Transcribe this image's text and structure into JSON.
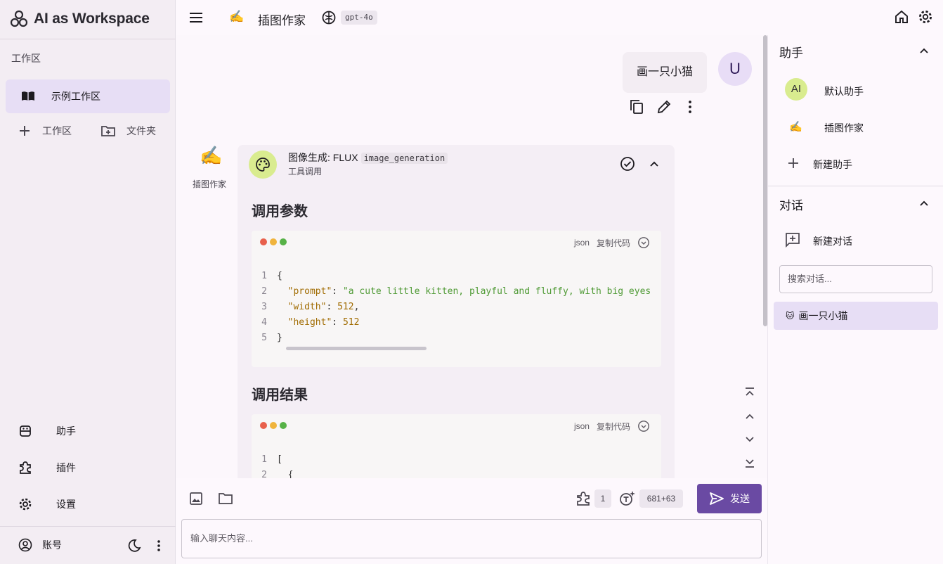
{
  "app": {
    "title": "AI as Workspace"
  },
  "sidebar": {
    "section_label": "工作区",
    "workspace_item": "示例工作区",
    "add_workspace": "工作区",
    "add_folder": "文件夹",
    "nav": [
      {
        "label": "助手",
        "icon": "robot-icon"
      },
      {
        "label": "插件",
        "icon": "puzzle-icon"
      },
      {
        "label": "设置",
        "icon": "gear-icon"
      }
    ],
    "account": "账号"
  },
  "header": {
    "assistant_emoji": "✍️",
    "assistant_name": "插图作家",
    "model": "gpt-4o"
  },
  "chat": {
    "user_message": "画一只小猫",
    "user_avatar": "U",
    "bot_emoji": "✍️",
    "bot_name": "插图作家",
    "tool_call": {
      "title": "图像生成: FLUX",
      "code_name": "image_generation",
      "subtitle": "工具调用",
      "params_heading": "调用参数",
      "result_heading": "调用结果",
      "lang": "json",
      "copy": "复制代码",
      "params_lines": [
        {
          "n": "1",
          "text": "{"
        },
        {
          "n": "2",
          "key": "\"prompt\"",
          "sep": ": ",
          "val": "\"a cute little kitten, playful and fluffy, with big eyes"
        },
        {
          "n": "3",
          "key": "\"width\"",
          "sep": ": ",
          "num": "512",
          "tail": ","
        },
        {
          "n": "4",
          "key": "\"height\"",
          "sep": ": ",
          "num": "512"
        },
        {
          "n": "5",
          "text": "}"
        }
      ],
      "result_lines": [
        {
          "n": "1",
          "text": "["
        },
        {
          "n": "2",
          "text": "  {"
        }
      ]
    }
  },
  "input": {
    "plugin_count": "1",
    "token_count": "681+63",
    "send_label": "发送",
    "placeholder": "输入聊天内容..."
  },
  "right_panel": {
    "assistants_heading": "助手",
    "assistants": [
      {
        "avatar": "AI",
        "name": "默认助手"
      },
      {
        "emoji": "✍️",
        "name": "插图作家"
      }
    ],
    "new_assistant": "新建助手",
    "conversations_heading": "对话",
    "new_conversation": "新建对话",
    "search_placeholder": "搜索对话...",
    "conversations": [
      {
        "emoji": "🐱",
        "title": "画一只小猫"
      }
    ]
  },
  "colors": {
    "accent": "#6a4aa3",
    "selected_bg": "#e7def5",
    "avatar_green": "#d9ec8f"
  }
}
